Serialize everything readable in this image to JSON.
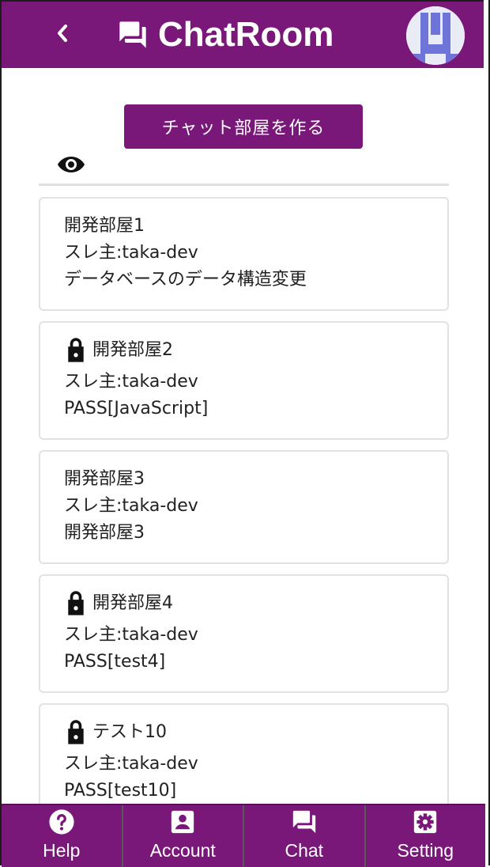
{
  "header": {
    "title": "ChatRoom",
    "back_icon": "chevron-left-icon",
    "brand_icon": "forum-icon",
    "avatar": "identicon-avatar"
  },
  "main": {
    "create_button_label": "チャット部屋を作る",
    "toggle_icon": "eye-icon",
    "rooms": [
      {
        "locked": false,
        "title": "開発部屋1",
        "owner": "スレ主:taka-dev",
        "detail": "データベースのデータ構造変更"
      },
      {
        "locked": true,
        "title": "開発部屋2",
        "owner": "スレ主:taka-dev",
        "detail": "PASS[JavaScript]"
      },
      {
        "locked": false,
        "title": "開発部屋3",
        "owner": "スレ主:taka-dev",
        "detail": "開発部屋3"
      },
      {
        "locked": true,
        "title": "開発部屋4",
        "owner": "スレ主:taka-dev",
        "detail": "PASS[test4]"
      },
      {
        "locked": true,
        "title": "テスト10",
        "owner": "スレ主:taka-dev",
        "detail": "PASS[test10]"
      }
    ]
  },
  "nav": {
    "items": [
      {
        "label": "Help",
        "icon": "help-icon"
      },
      {
        "label": "Account",
        "icon": "account-icon"
      },
      {
        "label": "Chat",
        "icon": "chat-icon"
      },
      {
        "label": "Setting",
        "icon": "settings-icon"
      }
    ]
  },
  "colors": {
    "primary": "#7a187a",
    "text": "#212121",
    "card_border": "#e2e2e2",
    "avatar_fg": "#6f74d8"
  }
}
